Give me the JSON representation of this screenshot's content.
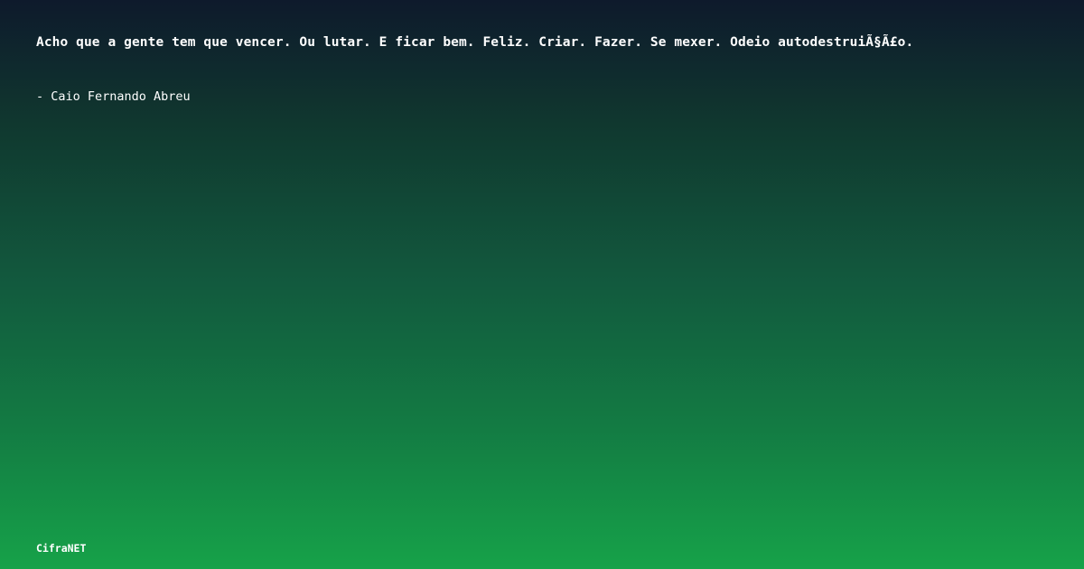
{
  "quote": {
    "text": "Acho que a gente tem que vencer. Ou lutar. E ficar bem. Feliz. Criar. Fazer. Se mexer. Odeio autodestruiÃ§Ã£o.",
    "author": "- Caio Fernando Abreu"
  },
  "brand": {
    "name": "CifraNET"
  },
  "colors": {
    "gradient_top": "#0e1a2c",
    "gradient_bottom": "#16a249",
    "text": "#ffffff"
  }
}
